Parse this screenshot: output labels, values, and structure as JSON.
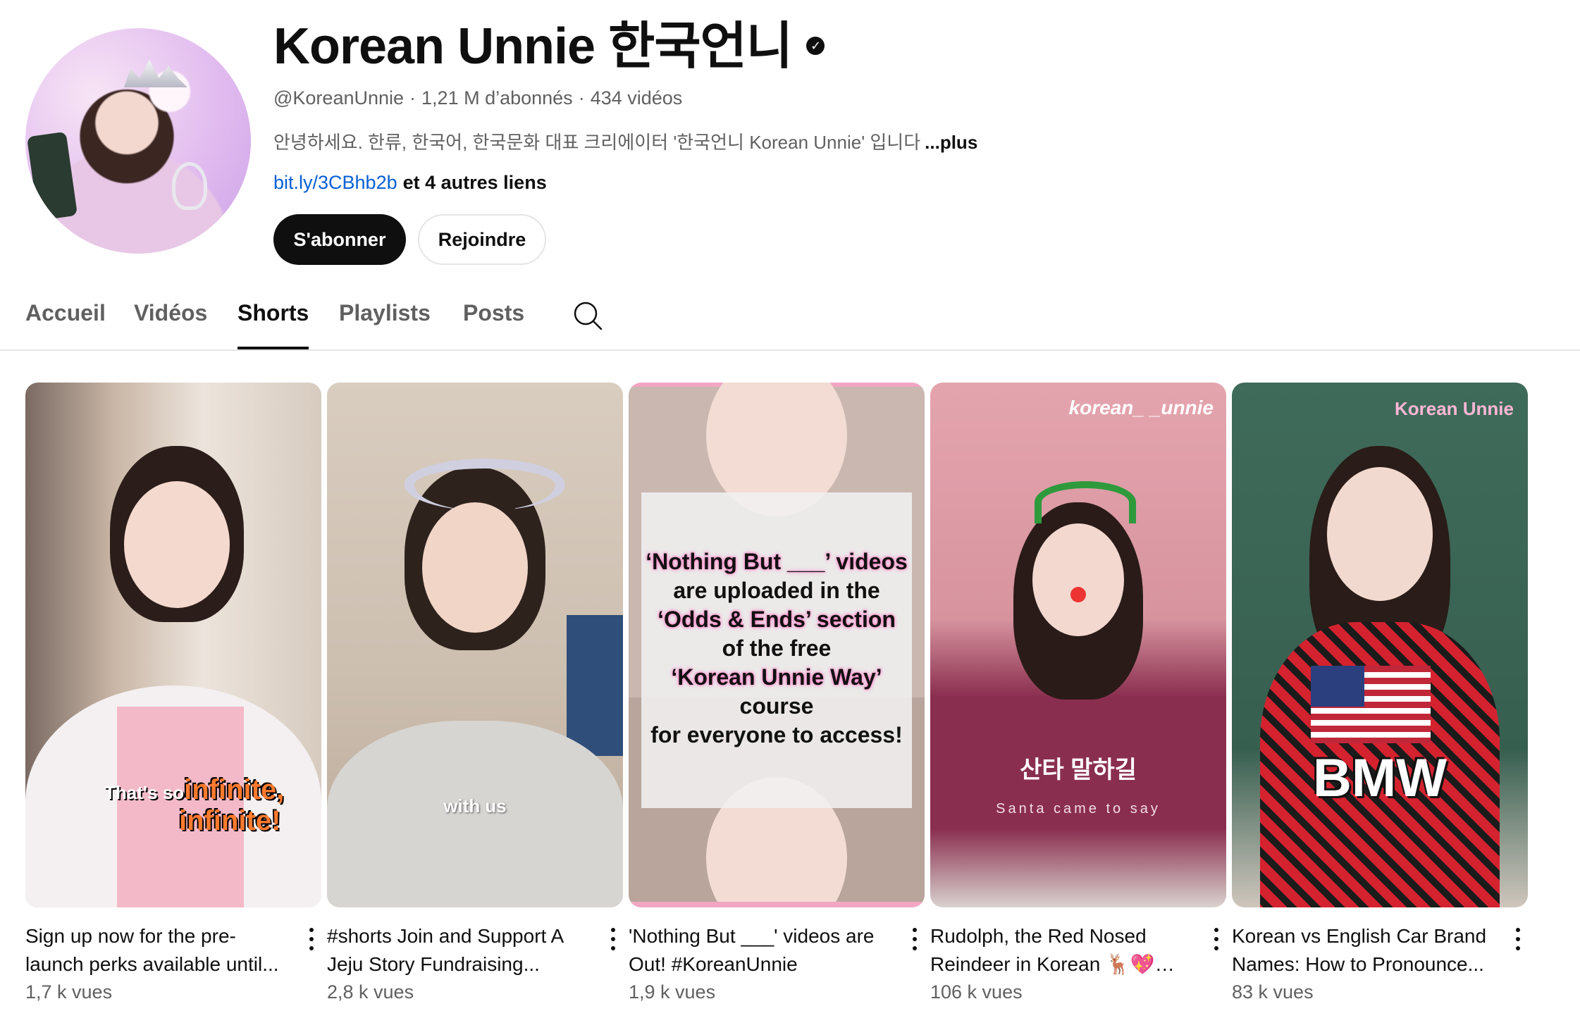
{
  "channel": {
    "name": "Korean Unnie 한국언니",
    "handle": "@KoreanUnnie",
    "subscribers": "1,21 M d’abonnés",
    "video_count": "434 vidéos",
    "description": "안녕하세요. 한류, 한국어, 한국문화 대표 크리에이터 '한국언니 Korean Unnie' 입니다",
    "more_label": "...plus",
    "link": "bit.ly/3CBhb2b",
    "link_rest": "et 4 autres liens",
    "subscribe_label": "S'abonner",
    "join_label": "Rejoindre",
    "verified_icon": "check-circle-icon"
  },
  "tabs": [
    {
      "label": "Accueil",
      "active": false
    },
    {
      "label": "Vidéos",
      "active": false
    },
    {
      "label": "Shorts",
      "active": true
    },
    {
      "label": "Playlists",
      "active": false
    },
    {
      "label": "Posts",
      "active": false
    }
  ],
  "shorts": [
    {
      "title": "Sign up now for the pre-launch perks available until...",
      "views": "1,7 k vues",
      "overlay_1a": "That's so",
      "overlay_1b": "infinite,",
      "overlay_2": "infinite!"
    },
    {
      "title": "#shorts Join and Support A Jeju Story Fundraising...",
      "views": "2,8 k vues",
      "overlay": "with us"
    },
    {
      "title": "'Nothing But ___' videos are Out! #KoreanUnnie",
      "views": "1,9 k vues",
      "overlay_lines": [
        "‘Nothing But ___’ videos",
        "are uploaded in the",
        "‘Odds & Ends’ section",
        "of the free",
        "‘Korean Unnie Way’",
        "course",
        "for everyone to access!"
      ]
    },
    {
      "title": "Rudolph, the Red Nosed Reindeer in Korean 🦌💖루돌...",
      "views": "106 k vues",
      "tag": "korean_ _unnie",
      "overlay_kr": "산타 말하길",
      "overlay_en": "Santa came to say"
    },
    {
      "title": "Korean vs English Car Brand Names: How to Pronounce...",
      "views": "83 k vues",
      "tag": "Korean Unnie",
      "overlay": "BMW"
    }
  ]
}
